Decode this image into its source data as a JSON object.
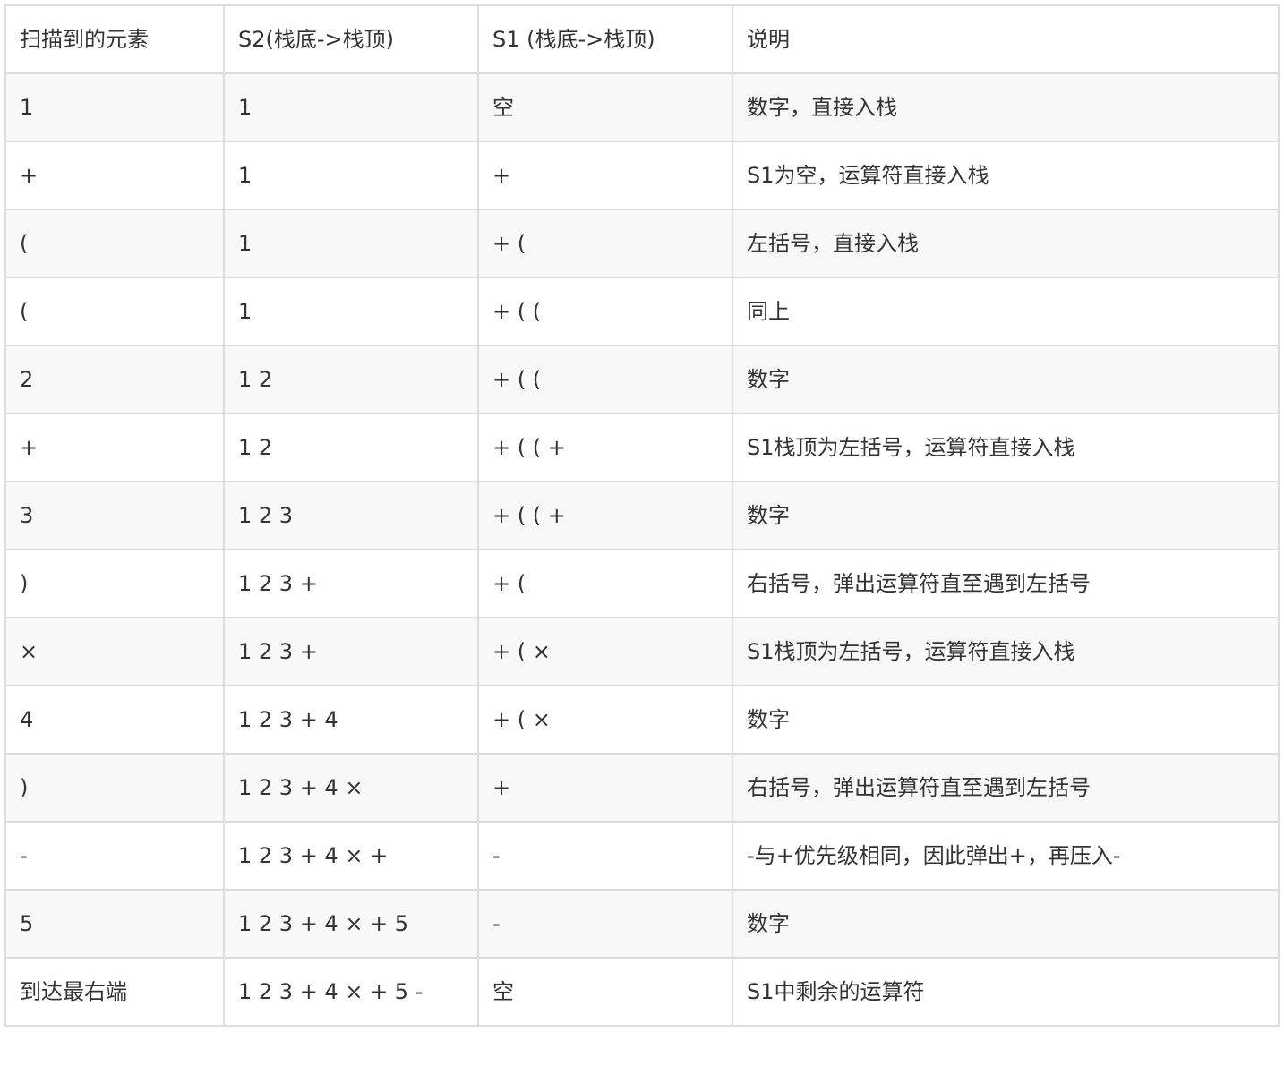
{
  "table": {
    "headers": [
      "扫描到的元素",
      "S2(栈底->栈顶)",
      "S1 (栈底->栈顶)",
      "说明"
    ],
    "rows": [
      [
        "1",
        "1",
        "空",
        "数字，直接入栈"
      ],
      [
        "+",
        "1",
        "+",
        "S1为空，运算符直接入栈"
      ],
      [
        "(",
        "1",
        "+ (",
        "左括号，直接入栈"
      ],
      [
        "(",
        "1",
        "+ ( (",
        "同上"
      ],
      [
        "2",
        "1 2",
        "+ ( (",
        "数字"
      ],
      [
        "+",
        "1 2",
        "+ ( ( +",
        "S1栈顶为左括号，运算符直接入栈"
      ],
      [
        "3",
        "1 2 3",
        "+ ( ( +",
        "数字"
      ],
      [
        ")",
        "1 2 3 +",
        "+ (",
        "右括号，弹出运算符直至遇到左括号"
      ],
      [
        "×",
        "1 2 3 +",
        "+ ( ×",
        "S1栈顶为左括号，运算符直接入栈"
      ],
      [
        "4",
        "1 2 3 + 4",
        "+ ( ×",
        "数字"
      ],
      [
        ")",
        "1 2 3 + 4 ×",
        "+",
        "右括号，弹出运算符直至遇到左括号"
      ],
      [
        "-",
        "1 2 3 + 4 × +",
        "-",
        "-与+优先级相同，因此弹出+，再压入-"
      ],
      [
        "5",
        "1 2 3 + 4 × + 5",
        "-",
        "数字"
      ],
      [
        "到达最右端",
        "1 2 3 + 4 × + 5 -",
        "空",
        "S1中剩余的运算符"
      ]
    ]
  },
  "colors": {
    "border": "#dddddd",
    "stripe": "#f8f8f8",
    "text": "#333333"
  }
}
